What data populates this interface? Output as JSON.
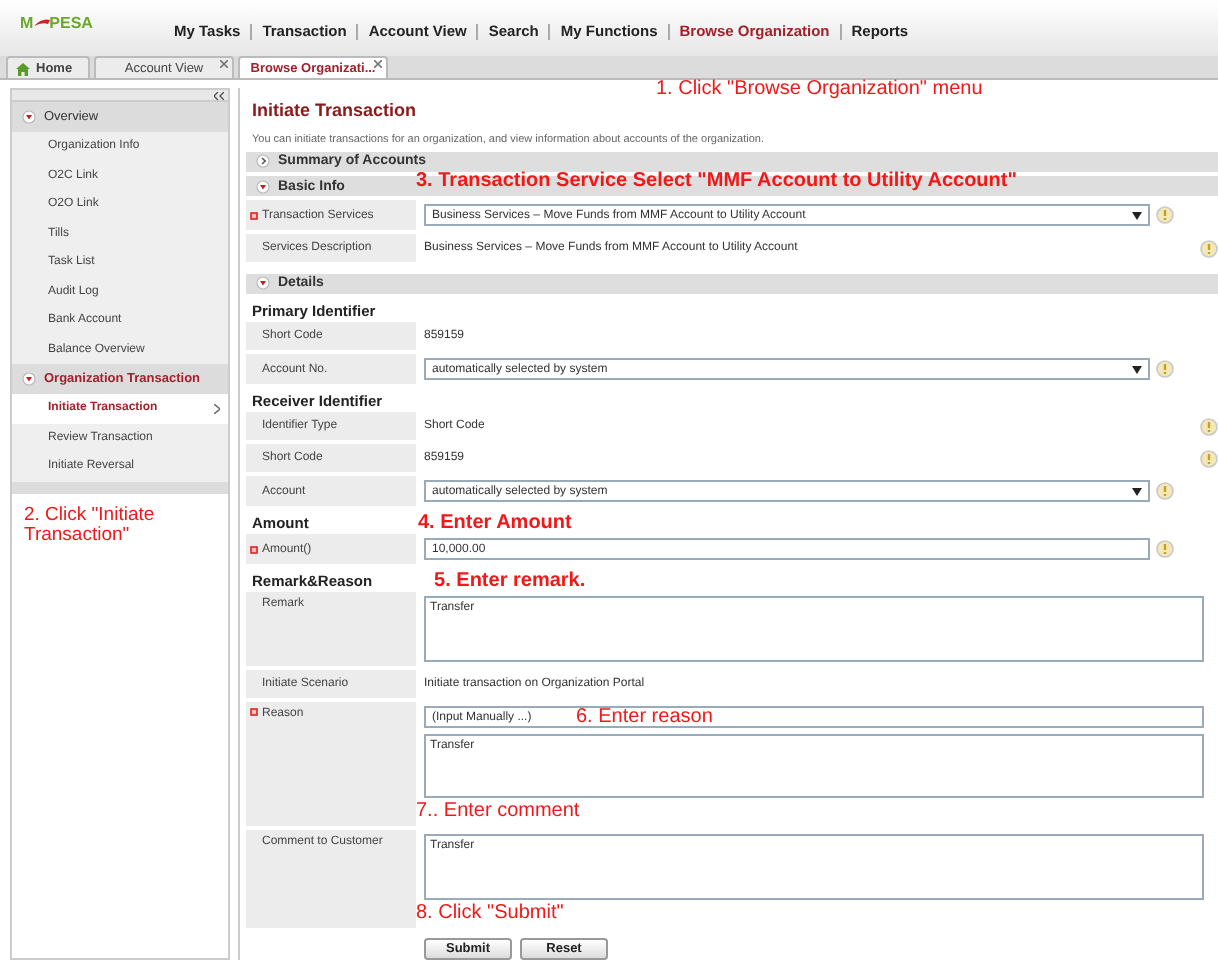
{
  "logo": {
    "left": "M",
    "right": "PESA"
  },
  "nav": [
    {
      "label": "My Tasks",
      "selected": false
    },
    {
      "label": "Transaction",
      "selected": false
    },
    {
      "label": "Account View",
      "selected": false
    },
    {
      "label": "Search",
      "selected": false
    },
    {
      "label": "My Functions",
      "selected": false
    },
    {
      "label": "Browse Organization",
      "selected": true
    },
    {
      "label": "Reports",
      "selected": false
    }
  ],
  "tabs": [
    {
      "label": "Home",
      "kind": "home",
      "selected": false,
      "closable": false
    },
    {
      "label": "Account View",
      "kind": "plain",
      "selected": false,
      "closable": true
    },
    {
      "label": "Browse Organizati...",
      "kind": "plain",
      "selected": true,
      "closable": true
    }
  ],
  "tab_annotation": "1. Click \"Browse Organization\" menu",
  "sidebar": {
    "sections": [
      {
        "title": "Overview",
        "expanded": true,
        "items": [
          {
            "label": "Organization Info",
            "selected": false
          },
          {
            "label": "O2C Link",
            "selected": false
          },
          {
            "label": "O2O Link",
            "selected": false
          },
          {
            "label": "Tills",
            "selected": false
          },
          {
            "label": "Task List",
            "selected": false
          },
          {
            "label": "Audit Log",
            "selected": false
          },
          {
            "label": "Bank Account",
            "selected": false
          },
          {
            "label": "Balance Overview",
            "selected": false
          }
        ]
      },
      {
        "title": "Organization Transaction",
        "expanded": true,
        "items": [
          {
            "label": "Initiate Transaction",
            "selected": true
          },
          {
            "label": "Review Transaction",
            "selected": false
          },
          {
            "label": "Initiate Reversal",
            "selected": false
          }
        ]
      }
    ],
    "annotation": "2. Click \"Initiate Transaction\""
  },
  "page": {
    "title": "Initiate Transaction",
    "description": "You can initiate transactions for an organization, and view information about accounts of the organization.",
    "sections": [
      {
        "title": "Summary of Accounts",
        "expanded": false
      },
      {
        "title": "Basic Info",
        "expanded": true,
        "annotation": "3. Transaction Service Select \"MMF Account to Utility Account\"",
        "groups": [
          {
            "rows": [
              {
                "label": "Transaction Services",
                "required": true,
                "kind": "select",
                "value": "Business Services – Move Funds from MMF Account to Utility Account",
                "info": true
              },
              {
                "label": "Services Description",
                "required": false,
                "kind": "text",
                "value": "Business Services – Move Funds from MMF Account to Utility Account",
                "info": true
              }
            ]
          }
        ]
      },
      {
        "title": "Details",
        "expanded": true,
        "groups": [
          {
            "heading": "Primary Identifier",
            "rows": [
              {
                "label": "Short Code",
                "required": false,
                "kind": "text",
                "value": "859159",
                "info": false
              },
              {
                "label": "Account No.",
                "required": false,
                "kind": "select",
                "value": "automatically selected by system",
                "info": true
              }
            ]
          },
          {
            "heading": "Receiver Identifier",
            "rows": [
              {
                "label": "Identifier Type",
                "required": false,
                "kind": "text",
                "value": "Short Code",
                "info": true
              },
              {
                "label": "Short Code",
                "required": false,
                "kind": "text",
                "value": "859159",
                "info": true
              },
              {
                "label": "Account",
                "required": false,
                "kind": "select",
                "value": "automatically selected by system",
                "info": true
              }
            ]
          },
          {
            "heading": "Amount",
            "annotation": "4. Enter Amount",
            "rows": [
              {
                "label": "Amount()",
                "required": true,
                "kind": "input",
                "value": "10,000.00",
                "info": true
              }
            ]
          },
          {
            "heading": "Remark&Reason",
            "annotation": "5. Enter remark.",
            "rows": [
              {
                "label": "Remark",
                "required": false,
                "kind": "textarea",
                "value": "Transfer",
                "info": false
              },
              {
                "label": "Initiate Scenario",
                "required": false,
                "kind": "text",
                "value": "Initiate transaction on Organization Portal",
                "info": false
              },
              {
                "label": "Reason",
                "required": true,
                "kind": "reason",
                "value": "(Input Manually ...)",
                "field_annotation": "6. Enter reason",
                "text": "Transfer",
                "after": "7.. Enter comment",
                "info": false
              },
              {
                "label": "Comment to Customer",
                "required": false,
                "kind": "textarea",
                "value": "Transfer",
                "after": "8. Click \"Submit\"",
                "info": false
              }
            ]
          }
        ]
      }
    ]
  },
  "buttons": [
    "Submit",
    "Reset"
  ]
}
